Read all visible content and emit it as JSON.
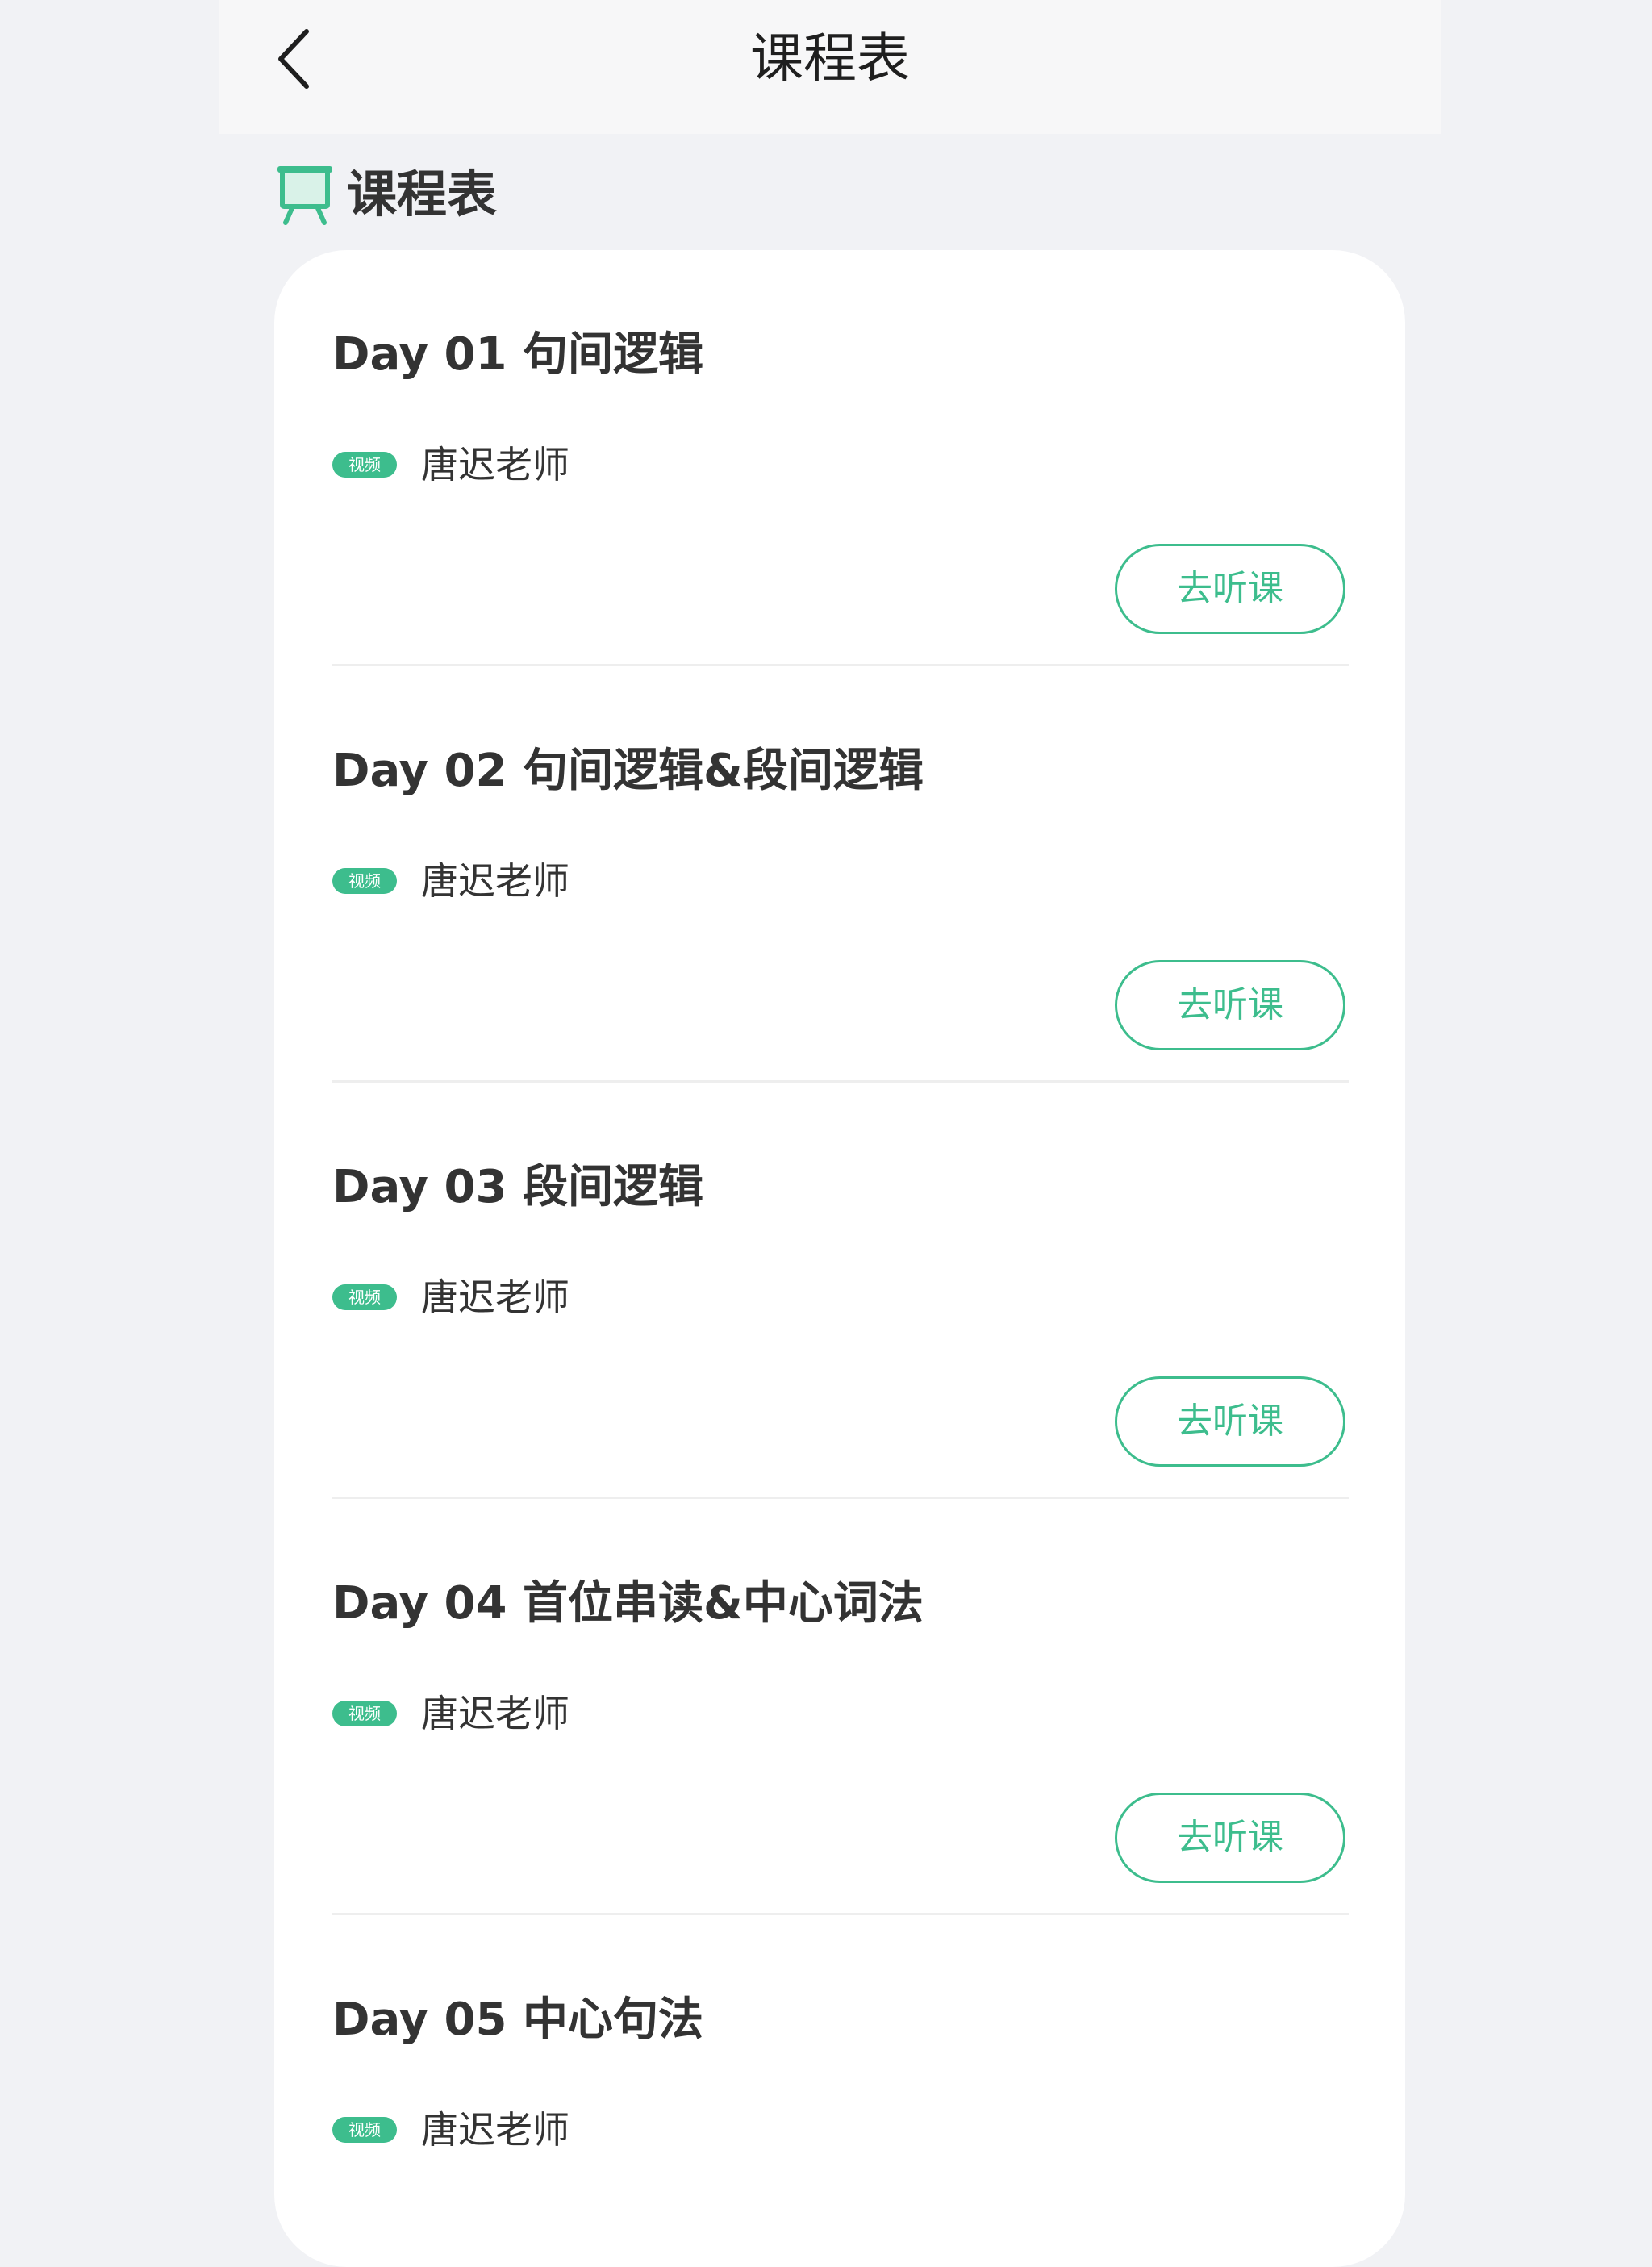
{
  "nav": {
    "title": "课程表"
  },
  "section": {
    "title": "课程表"
  },
  "theme": {
    "accent": "#3dbd8d",
    "icon_name": "presentation-board-icon",
    "back_icon_name": "chevron-left-icon"
  },
  "courses": [
    {
      "title": "Day 01 句间逻辑",
      "badge": "视频",
      "teacher": "唐迟老师",
      "button": "去听课"
    },
    {
      "title": "Day 02 句间逻辑&段间逻辑",
      "badge": "视频",
      "teacher": "唐迟老师",
      "button": "去听课"
    },
    {
      "title": "Day 03 段间逻辑",
      "badge": "视频",
      "teacher": "唐迟老师",
      "button": "去听课"
    },
    {
      "title": "Day 04 首位串读&中心词法",
      "badge": "视频",
      "teacher": "唐迟老师",
      "button": "去听课"
    },
    {
      "title": "Day 05 中心句法",
      "badge": "视频",
      "teacher": "唐迟老师"
    }
  ]
}
